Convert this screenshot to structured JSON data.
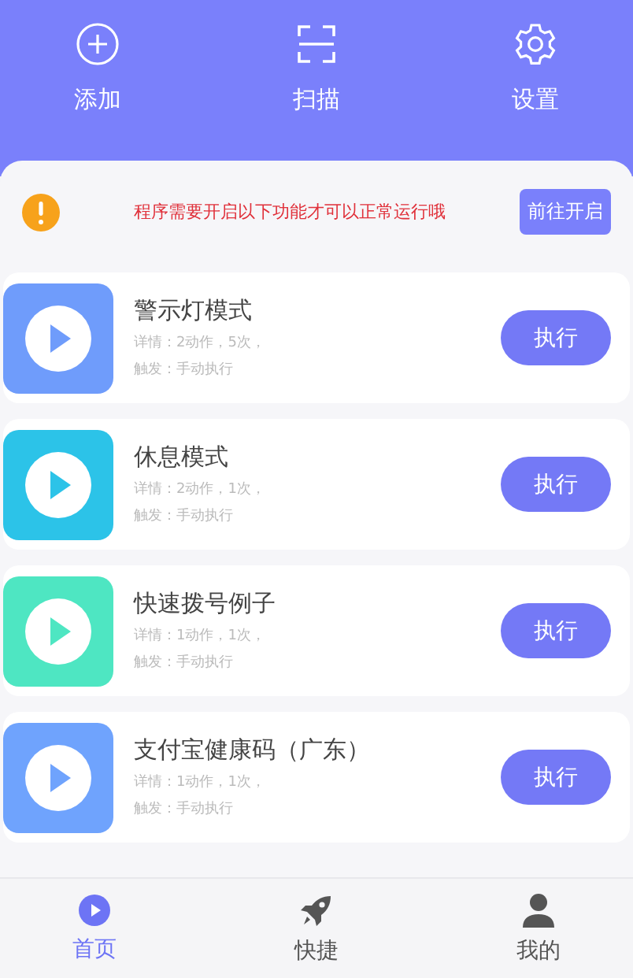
{
  "actions": [
    {
      "kind": "add",
      "label": "添加"
    },
    {
      "kind": "scan",
      "label": "扫描"
    },
    {
      "kind": "settings",
      "label": "设置"
    }
  ],
  "notice": {
    "text": "程序需要开启以下功能才可以正常运行哦",
    "button": "前往开启"
  },
  "tasks": [
    {
      "name": "警示灯模式",
      "detail": "详情：2动作，5次，",
      "trigger": "触发：手动执行",
      "color": "#6f9cfb",
      "button": "执行"
    },
    {
      "name": "休息模式",
      "detail": "详情：2动作，1次，",
      "trigger": "触发：手动执行",
      "color": "#2cc3e8",
      "button": "执行"
    },
    {
      "name": "快速拨号例子",
      "detail": "详情：1动作，1次，",
      "trigger": "触发：手动执行",
      "color": "#4ee6c2",
      "button": "执行"
    },
    {
      "name": "支付宝健康码（广东）",
      "detail": "详情：1动作，1次，",
      "trigger": "触发：手动执行",
      "color": "#6fa3fd",
      "button": "执行"
    }
  ],
  "tabs": [
    {
      "kind": "home",
      "label": "首页",
      "selected": true
    },
    {
      "kind": "rocket",
      "label": "快捷",
      "selected": false
    },
    {
      "kind": "person",
      "label": "我的",
      "selected": false
    }
  ]
}
